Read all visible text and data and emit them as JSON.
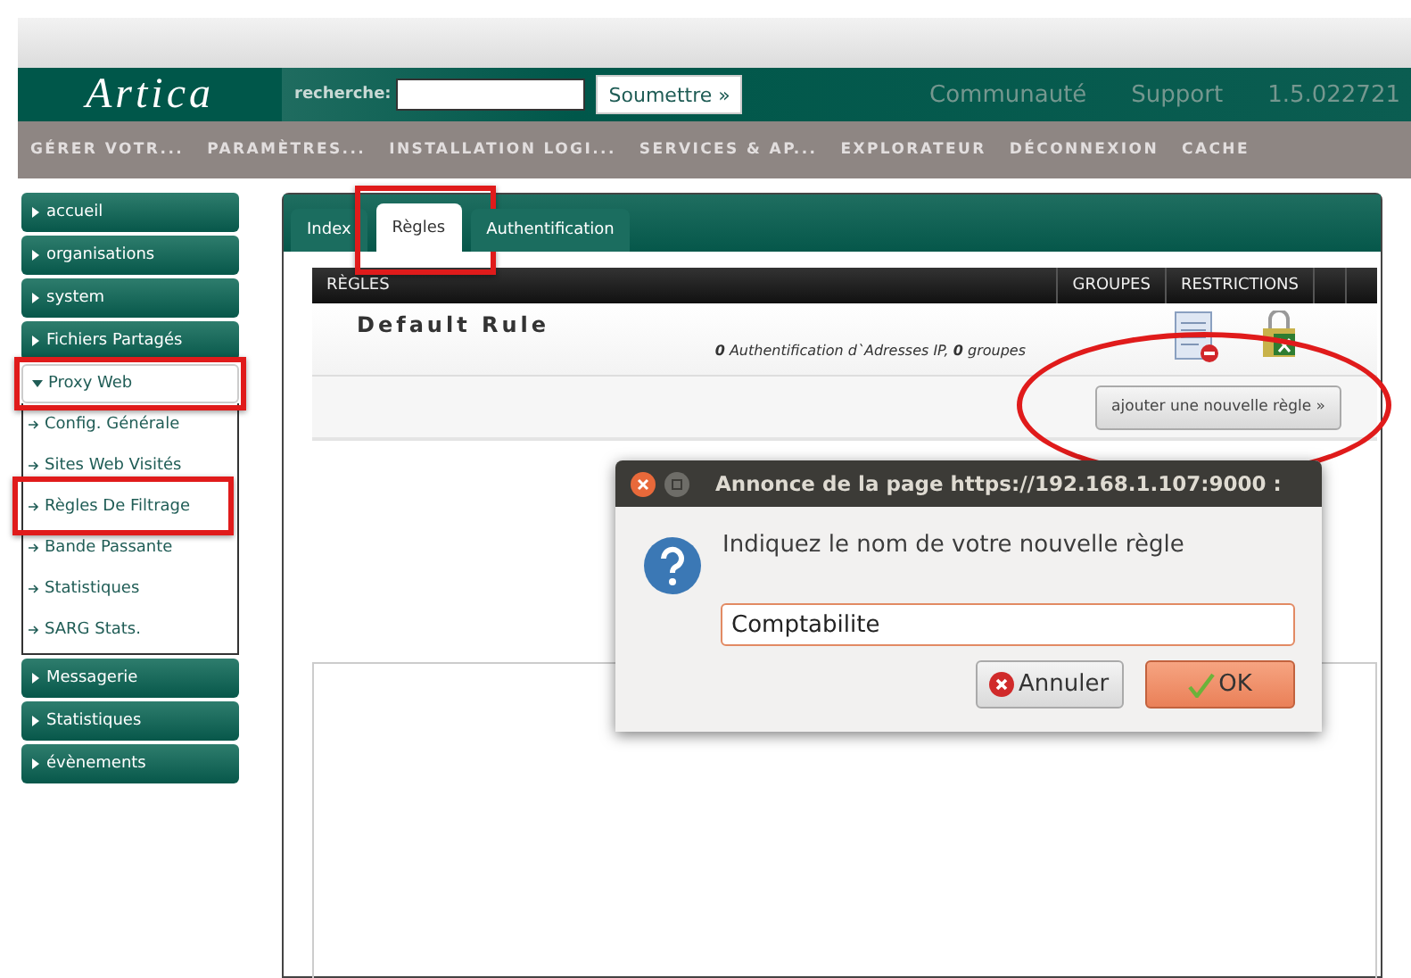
{
  "header": {
    "logo": "Artica",
    "search_label": "recherche:",
    "submit": "Soumettre »",
    "links": [
      "Communauté",
      "Support",
      "1.5.022721"
    ]
  },
  "nav": [
    "GÉRER VOTR...",
    "PARAMÈTRES...",
    "INSTALLATION LOGI...",
    "SERVICES & AP...",
    "EXPLORATEUR",
    "DÉCONNEXION",
    "CACHE"
  ],
  "sidebar": [
    {
      "label": "accueil",
      "expanded": false,
      "highlighted": false
    },
    {
      "label": "organisations",
      "expanded": false,
      "highlighted": false
    },
    {
      "label": "system",
      "expanded": false,
      "highlighted": false
    },
    {
      "label": "Fichiers Partagés",
      "expanded": false,
      "highlighted": false
    },
    {
      "label": "Proxy Web",
      "expanded": true,
      "highlighted": true,
      "children": [
        {
          "label": "Config. Générale",
          "highlighted": false
        },
        {
          "label": "Sites Web Visités",
          "highlighted": false
        },
        {
          "label": "Règles De Filtrage",
          "highlighted": true
        },
        {
          "label": "Bande Passante",
          "highlighted": false
        },
        {
          "label": "Statistiques",
          "highlighted": false
        },
        {
          "label": "SARG Stats.",
          "highlighted": false
        }
      ]
    },
    {
      "label": "Messagerie",
      "expanded": false,
      "highlighted": false
    },
    {
      "label": "Statistiques",
      "expanded": false,
      "highlighted": false
    },
    {
      "label": "évènements",
      "expanded": false,
      "highlighted": false
    }
  ],
  "tabs": [
    {
      "label": "Index",
      "selected": false,
      "highlighted": false
    },
    {
      "label": "Règles",
      "selected": true,
      "highlighted": true
    },
    {
      "label": "Authentification",
      "selected": false,
      "highlighted": false
    }
  ],
  "table": {
    "columns": [
      "RÈGLES",
      "GROUPES",
      "RESTRICTIONS"
    ],
    "rows": [
      {
        "name": "Default Rule",
        "summary": "**0** Authentification d`Adresses IP, **0** groupes"
      }
    ]
  },
  "add_button": {
    "label": "ajouter une nouvelle règle »",
    "highlighted": true
  },
  "dialog": {
    "title": "Annonce de la page https://192.168.1.107:9000 :",
    "message": "Indiquez le nom de votre nouvelle règle",
    "value": "Comptabilite",
    "buttons": [
      {
        "label": "Annuler",
        "kind": "cancel"
      },
      {
        "label": "OK",
        "kind": "ok"
      }
    ]
  }
}
